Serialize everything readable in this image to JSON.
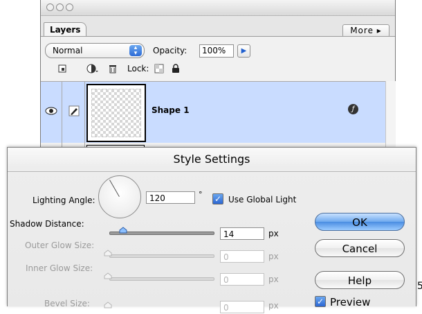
{
  "layers_window": {
    "tab_label": "Layers",
    "more_label": "More ▸",
    "blend_mode": "Normal",
    "opacity_label": "Opacity:",
    "opacity_value": "100%",
    "lock_label": "Lock:",
    "layer_name": "Shape 1"
  },
  "dialog": {
    "title": "Style Settings",
    "lighting_angle_label": "Lighting Angle:",
    "lighting_angle_value": "120",
    "degree_symbol": "°",
    "use_global_light_label": "Use Global Light",
    "use_global_light_checked": true,
    "rows": [
      {
        "label": "Shadow Distance:",
        "value": "14",
        "unit": "px",
        "enabled": true
      },
      {
        "label": "Outer Glow Size:",
        "value": "0",
        "unit": "px",
        "enabled": false
      },
      {
        "label": "Inner Glow Size:",
        "value": "0",
        "unit": "px",
        "enabled": false
      },
      {
        "label": "Bevel Size:",
        "value": "0",
        "unit": "px",
        "enabled": false
      }
    ],
    "buttons": {
      "ok": "OK",
      "cancel": "Cancel",
      "help": "Help"
    },
    "preview_label": "Preview",
    "preview_checked": true
  },
  "edge_text": "5"
}
